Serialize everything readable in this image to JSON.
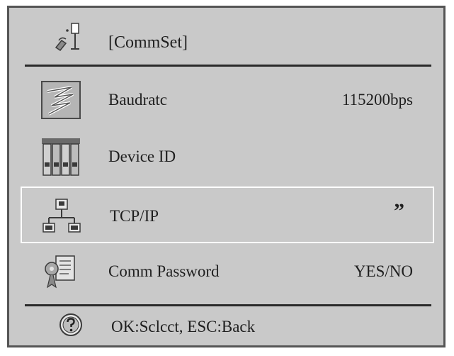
{
  "header": {
    "title": "[CommSet]",
    "icon": "comm-settings-icon"
  },
  "menu": {
    "items": [
      {
        "label": "Baudratc",
        "value": "115200bps",
        "icon": "baudrate-icon"
      },
      {
        "label": "Device ID",
        "value": "",
        "icon": "device-id-icon"
      },
      {
        "label": "TCP/IP",
        "value": "”",
        "icon": "network-icon",
        "selected": true
      },
      {
        "label": "Comm Password",
        "value": "YES/NO",
        "icon": "password-icon"
      }
    ]
  },
  "footer": {
    "hint": "OK:Sclcct, ESC:Back",
    "icon": "help-icon"
  },
  "colors": {
    "background": "#c9c9c9",
    "border": "#555555",
    "divider": "#2a2a2a",
    "selection": "#ffffff",
    "text": "#1f1f1f"
  }
}
